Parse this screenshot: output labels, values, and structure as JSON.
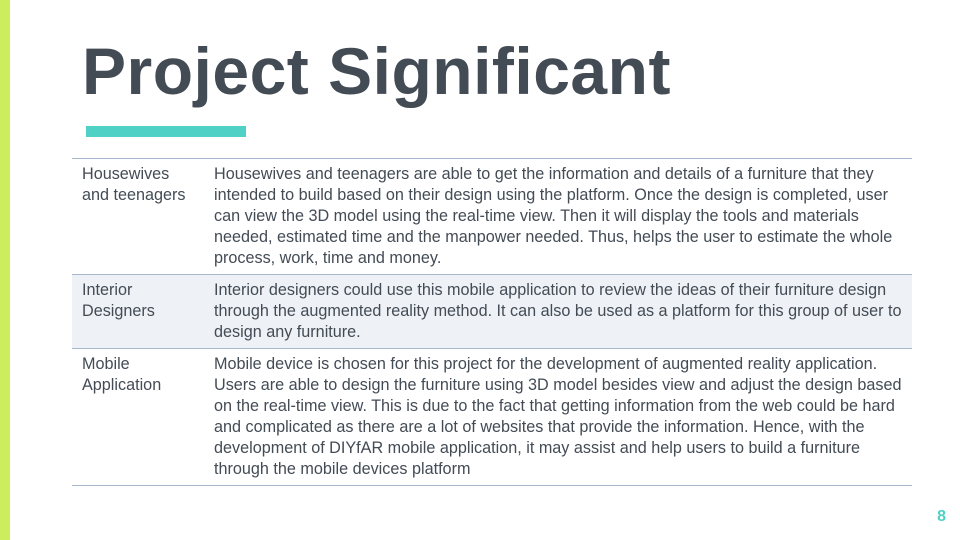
{
  "slide": {
    "title": "Project Significant",
    "page_number": "8"
  },
  "rows": [
    {
      "label": "Housewives and teenagers",
      "description": "Housewives and teenagers are able to get the information and details of a furniture that they intended to build based on their design using the platform. Once the design is completed, user can view the 3D model using the real-time view. Then it will display the tools and materials needed, estimated time and the manpower needed. Thus, helps the user to estimate the whole process, work, time and money."
    },
    {
      "label": "Interior Designers",
      "description": "Interior designers could use this mobile application to review the ideas of their furniture design through the augmented reality method. It can also be used as a platform for this group of user to design any furniture."
    },
    {
      "label": "Mobile Application",
      "description": "Mobile device is chosen for this project for the development of augmented reality application.  Users are able to design the furniture using 3D model besides view and adjust the design based on the real-time view. This is due to the fact that getting information from the web could be hard and complicated as there are a lot of websites that provide the information. Hence, with the development of DIYfAR mobile application, it may assist and help users to build a furniture through the mobile devices platform"
    }
  ],
  "colors": {
    "accent_bar": "#cdee5c",
    "title_text": "#434b55",
    "underline": "#4fd1c5",
    "row_shade": "#eef2f6",
    "rule": "#a8b8cc",
    "page_number": "#4fd1c5"
  }
}
